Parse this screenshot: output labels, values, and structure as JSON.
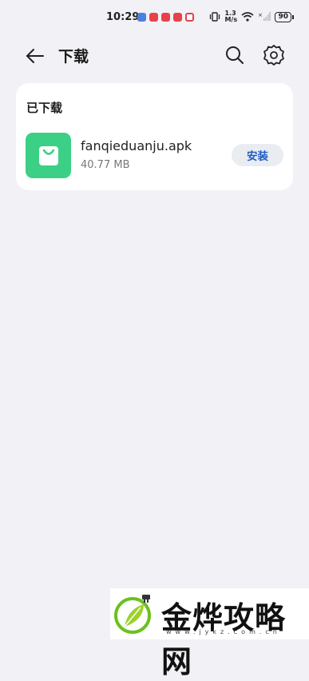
{
  "status_bar": {
    "time": "10:29",
    "network_speed": "1.3 M/s",
    "battery": "90"
  },
  "app_bar": {
    "title": "下载"
  },
  "downloads": {
    "section_title": "已下载",
    "items": [
      {
        "file_name": "fanqieduanju.apk",
        "file_size": "40.77 MB",
        "action_label": "安装",
        "icon": "shopping-bag-icon",
        "icon_color": "#3cd086"
      }
    ]
  },
  "watermark": {
    "text": "金烨攻略网",
    "url": "www.jykz.com.cn"
  },
  "colors": {
    "background": "#f1f1f6",
    "accent": "#1f5fc6",
    "card": "#ffffff"
  }
}
